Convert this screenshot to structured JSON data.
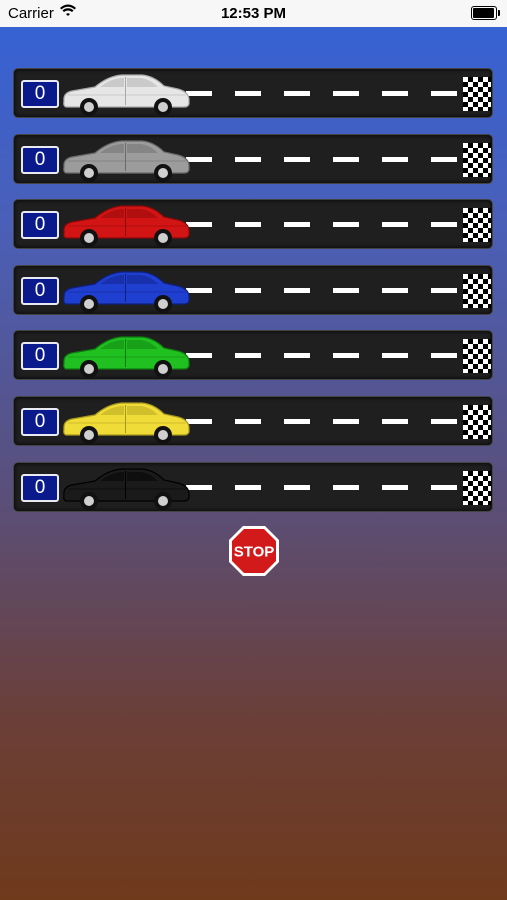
{
  "status_bar": {
    "carrier": "Carrier",
    "time": "12:53 PM"
  },
  "lanes": [
    {
      "count": "0",
      "car_color": "#e6e6e6",
      "car_dark": "#a8a8a8"
    },
    {
      "count": "0",
      "car_color": "#9c9c9c",
      "car_dark": "#6a6a6a"
    },
    {
      "count": "0",
      "car_color": "#d21414",
      "car_dark": "#8a0808"
    },
    {
      "count": "0",
      "car_color": "#1f3fd0",
      "car_dark": "#0f2080"
    },
    {
      "count": "0",
      "car_color": "#21c021",
      "car_dark": "#0e7a0e"
    },
    {
      "count": "0",
      "car_color": "#f0dc38",
      "car_dark": "#a8981c"
    },
    {
      "count": "0",
      "car_color": "#1a1a1a",
      "car_dark": "#000000"
    }
  ],
  "stop_button": {
    "label": "STOP"
  }
}
